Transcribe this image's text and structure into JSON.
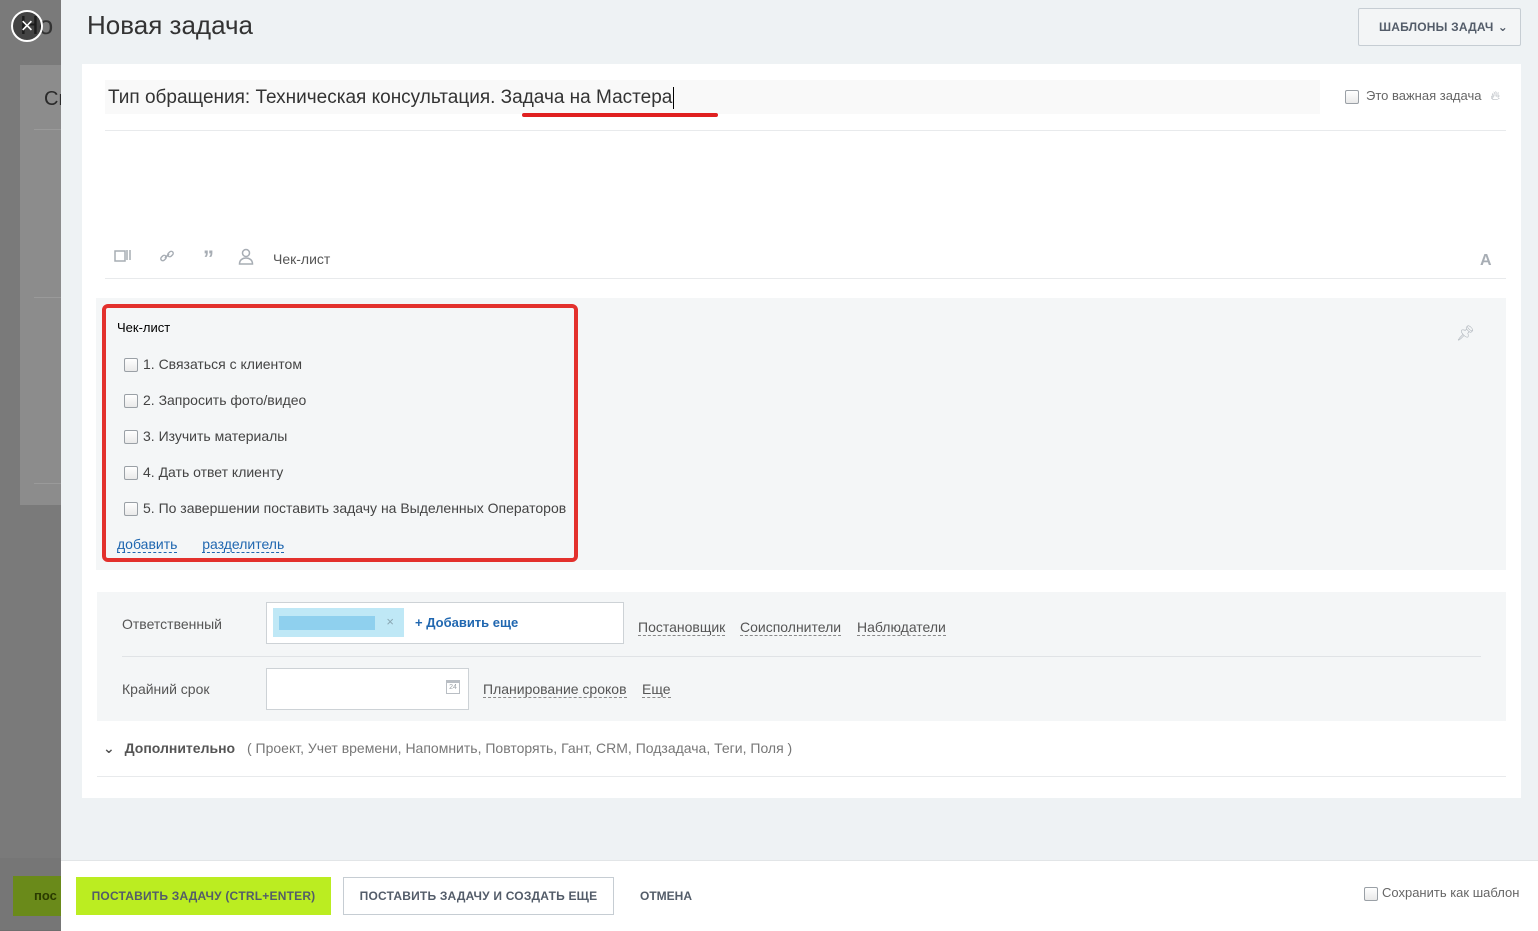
{
  "background": {
    "title_peek": "Но",
    "card_text": "Сп",
    "button_peek": "пос"
  },
  "panel": {
    "title": "Новая задача",
    "templates_button": "ШАБЛОНЫ ЗАДАЧ",
    "task_title": "Тип обращения: Техническая консультация. Задача на Мастера",
    "important_label": "Это важная задача",
    "toolbar": {
      "icons": [
        "file-icon",
        "link-icon",
        "quote-icon",
        "mention-icon"
      ],
      "checklist_label": "Чек-лист",
      "font_label": "A"
    },
    "checklist": {
      "title": "Чек-лист",
      "items": [
        "1. Связаться с клиентом",
        "2. Запросить фото/видео",
        "3. Изучить материалы",
        "4. Дать ответ клиенту",
        "5. По завершении поставить задачу на Выделенных Операторов"
      ],
      "add_link": "добавить",
      "separator_link": "разделитель"
    },
    "fields": {
      "responsible_label": "Ответственный",
      "add_more": "+ Добавить еще",
      "roles": [
        "Постановщик",
        "Соисполнители",
        "Наблюдатели"
      ],
      "deadline_label": "Крайний срок",
      "deadline_value": "",
      "planning_link": "Планирование сроков",
      "more_link": "Еще"
    },
    "additional": {
      "title": "Дополнительно",
      "items": "( Проект,  Учет времени,  Напомнить,  Повторять,  Гант,  CRM,  Подзадача,  Теги,  Поля )"
    },
    "footer": {
      "submit": "ПОСТАВИТЬ ЗАДАЧУ (CTRL+ENTER)",
      "submit_and_create": "ПОСТАВИТЬ ЗАДАЧУ И СОЗДАТЬ ЕЩЕ",
      "cancel": "ОТМЕНА",
      "save_as_template": "Сохранить как шаблон"
    }
  },
  "colors": {
    "primary_button": "#bbed21",
    "link": "#2067b0",
    "highlight_red": "#e3312d"
  }
}
